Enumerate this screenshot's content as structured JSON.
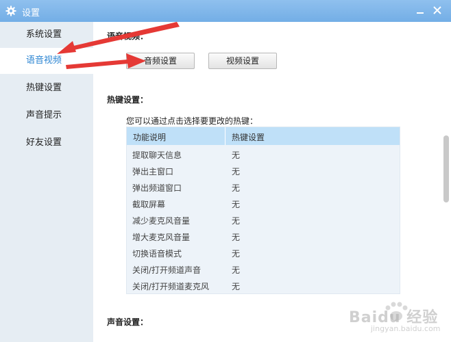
{
  "window": {
    "title": "设置"
  },
  "sidebar": {
    "items": [
      {
        "label": "系统设置",
        "active": false
      },
      {
        "label": "语音视频",
        "active": true
      },
      {
        "label": "热键设置",
        "active": false
      },
      {
        "label": "声音提示",
        "active": false
      },
      {
        "label": "好友设置",
        "active": false
      }
    ]
  },
  "main": {
    "voice_video": {
      "title": "语音视频：",
      "audio_button": "音频设置",
      "video_button": "视频设置"
    },
    "hotkeys": {
      "title": "热键设置：",
      "hint": "您可以通过点击选择要更改的热键：",
      "columns": [
        "功能说明",
        "热键设置"
      ],
      "rows": [
        {
          "function": "提取聊天信息",
          "key": "无"
        },
        {
          "function": "弹出主窗口",
          "key": "无"
        },
        {
          "function": "弹出频道窗口",
          "key": "无"
        },
        {
          "function": "截取屏幕",
          "key": "无"
        },
        {
          "function": "减少麦克风音量",
          "key": "无"
        },
        {
          "function": "增大麦克风音量",
          "key": "无"
        },
        {
          "function": "切换语音模式",
          "key": "无"
        },
        {
          "function": "关闭/打开频道声音",
          "key": "无"
        },
        {
          "function": "关闭/打开频道麦克风",
          "key": "无"
        }
      ]
    },
    "sound": {
      "title": "声音设置："
    }
  },
  "watermark": {
    "text": "Baidu 经验",
    "sub": "jingyan.baidu.com"
  },
  "colors": {
    "titlebar": "#7fb5ea",
    "sidebar": "#e6edf3",
    "active_text": "#2a84d2",
    "table_header": "#bfe0f8",
    "table_body": "#edf3f9",
    "annotation": "#e53935"
  },
  "icons": {
    "title": "gear-icon",
    "minimize": "minimize-icon",
    "close": "close-icon"
  }
}
